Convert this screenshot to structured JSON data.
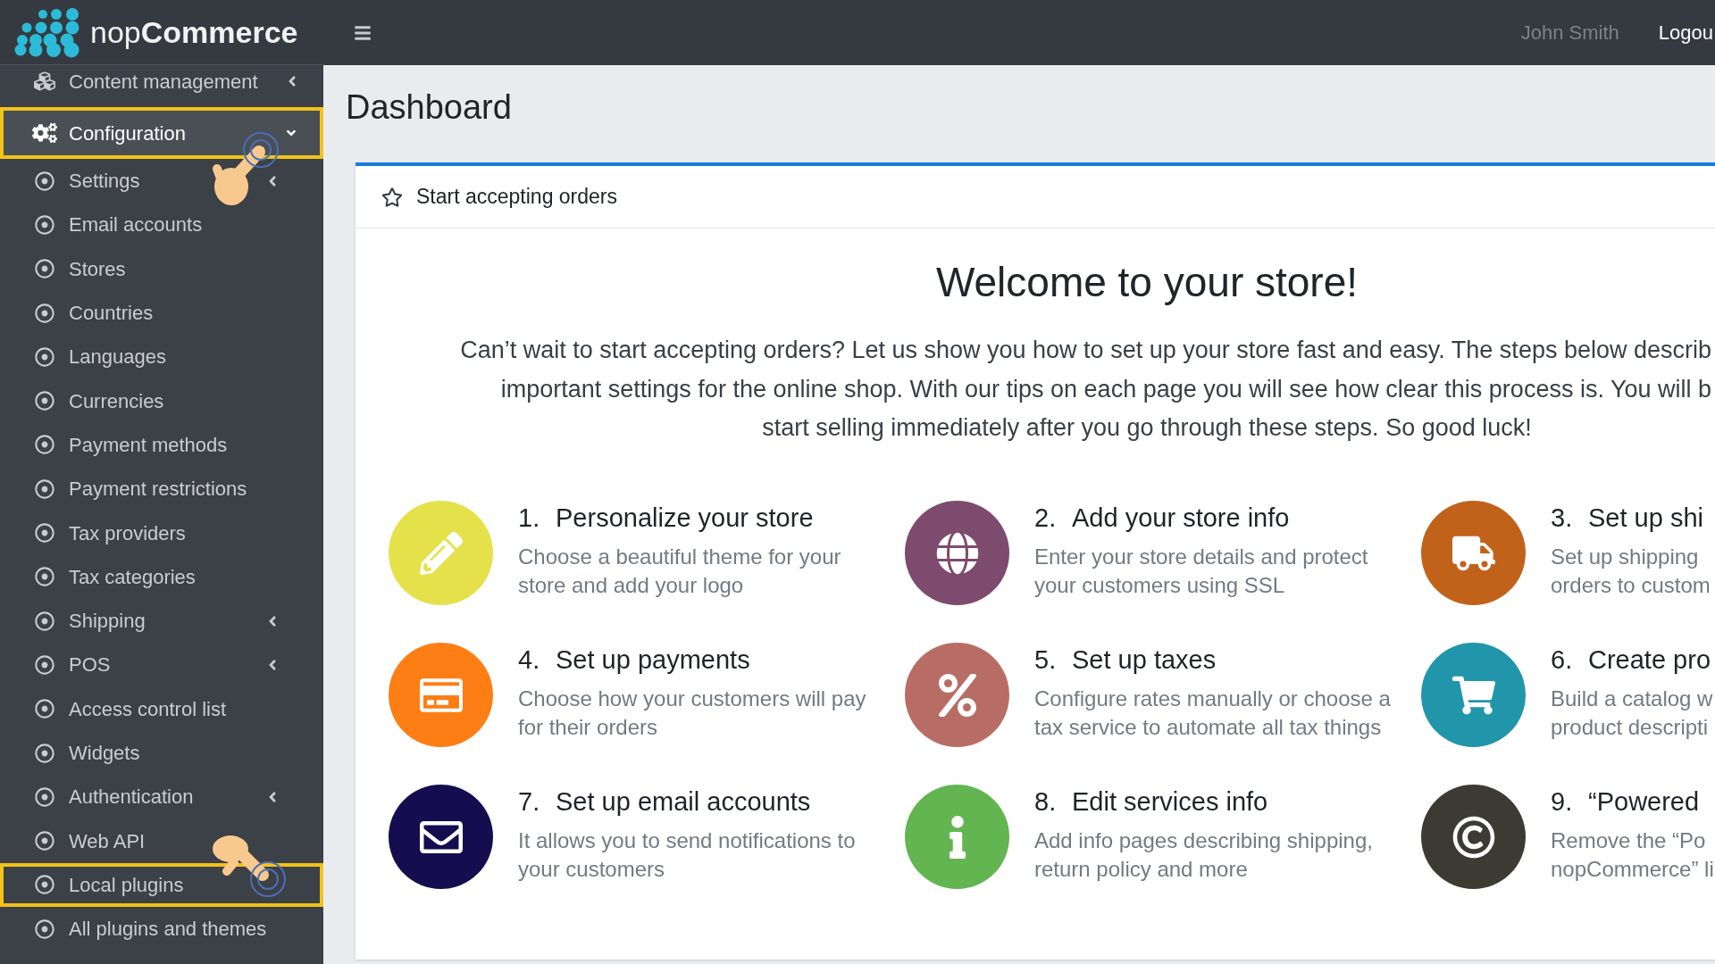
{
  "header": {
    "logo": "nop**Commerce**",
    "user_name": "John Smith",
    "logout": "Logou"
  },
  "sidebar": {
    "items": [
      {
        "label": "Content management",
        "selected": false,
        "expanded": false,
        "highlighted": false
      },
      {
        "label": "Configuration",
        "selected": true,
        "expanded": true,
        "highlighted": true,
        "children": [
          {
            "label": "Settings",
            "selected": false,
            "expanded": false,
            "highlighted": false
          },
          {
            "label": "Email accounts",
            "selected": false,
            "highlighted": false
          },
          {
            "label": "Stores",
            "selected": false,
            "highlighted": false
          },
          {
            "label": "Countries",
            "selected": false,
            "highlighted": false
          },
          {
            "label": "Languages",
            "selected": false,
            "highlighted": false
          },
          {
            "label": "Currencies",
            "selected": false,
            "highlighted": false
          },
          {
            "label": "Payment methods",
            "selected": false,
            "highlighted": false
          },
          {
            "label": "Payment restrictions",
            "selected": false,
            "highlighted": false
          },
          {
            "label": "Tax providers",
            "selected": false,
            "highlighted": false
          },
          {
            "label": "Tax categories",
            "selected": false,
            "highlighted": false
          },
          {
            "label": "Shipping",
            "selected": false,
            "expanded": false,
            "highlighted": false
          },
          {
            "label": "POS",
            "selected": false,
            "expanded": false,
            "highlighted": false
          },
          {
            "label": "Access control list",
            "selected": false,
            "highlighted": false
          },
          {
            "label": "Widgets",
            "selected": false,
            "highlighted": false
          },
          {
            "label": "Authentication",
            "selected": false,
            "expanded": false,
            "highlighted": false
          },
          {
            "label": "Web API",
            "selected": false,
            "highlighted": false
          },
          {
            "label": "Local plugins",
            "selected": false,
            "highlighted": true
          },
          {
            "label": "All plugins and themes",
            "selected": false,
            "highlighted": false
          }
        ]
      }
    ]
  },
  "page_title": "Dashboard",
  "card": {
    "title": "Start accepting orders",
    "heading": "Welcome to your store!",
    "intro_lines": [
      "Can’t wait to start accepting orders? Let us show you how to set up your store fast and easy. The steps below describ",
      "important settings for the online shop. With our tips on each page you will see how clear this process is. You will b",
      "start selling immediately after you go through these steps. So good luck!"
    ],
    "steps": [
      {
        "number": "1.",
        "title": "Personalize your store",
        "lines": [
          "Choose a beautiful theme for your",
          "store and add your logo"
        ],
        "color": "#e5e14b"
      },
      {
        "number": "2.",
        "title": "Add your store info",
        "lines": [
          "Enter your store details and protect",
          "your customers using SSL"
        ],
        "color": "#7d4b6e"
      },
      {
        "number": "3.",
        "title": "Set up shi",
        "lines": [
          "Set up shipping",
          "orders to custom"
        ],
        "color": "#c1621b"
      },
      {
        "number": "4.",
        "title": "Set up payments",
        "lines": [
          "Choose how your customers will pay",
          "for their orders"
        ],
        "color": "#fd7e14"
      },
      {
        "number": "5.",
        "title": "Set up taxes",
        "lines": [
          "Configure rates manually or choose a",
          "tax service to automate all tax things"
        ],
        "color": "#b76d65"
      },
      {
        "number": "6.",
        "title": "Create pro",
        "lines": [
          "Build a catalog w",
          "product descripti"
        ],
        "color": "#2196aa"
      },
      {
        "number": "7.",
        "title": "Set up email accounts",
        "lines": [
          "It allows you to send notifications to",
          "your customers"
        ],
        "color": "#150d50"
      },
      {
        "number": "8.",
        "title": "Edit services info",
        "lines": [
          "Add info pages describing shipping,",
          "return policy and more"
        ],
        "color": "#62b550"
      },
      {
        "number": "9.",
        "title": "“Powered",
        "lines": [
          "Remove the “Po",
          "nopCommerce” li"
        ],
        "color": "#3c3b33"
      }
    ]
  }
}
